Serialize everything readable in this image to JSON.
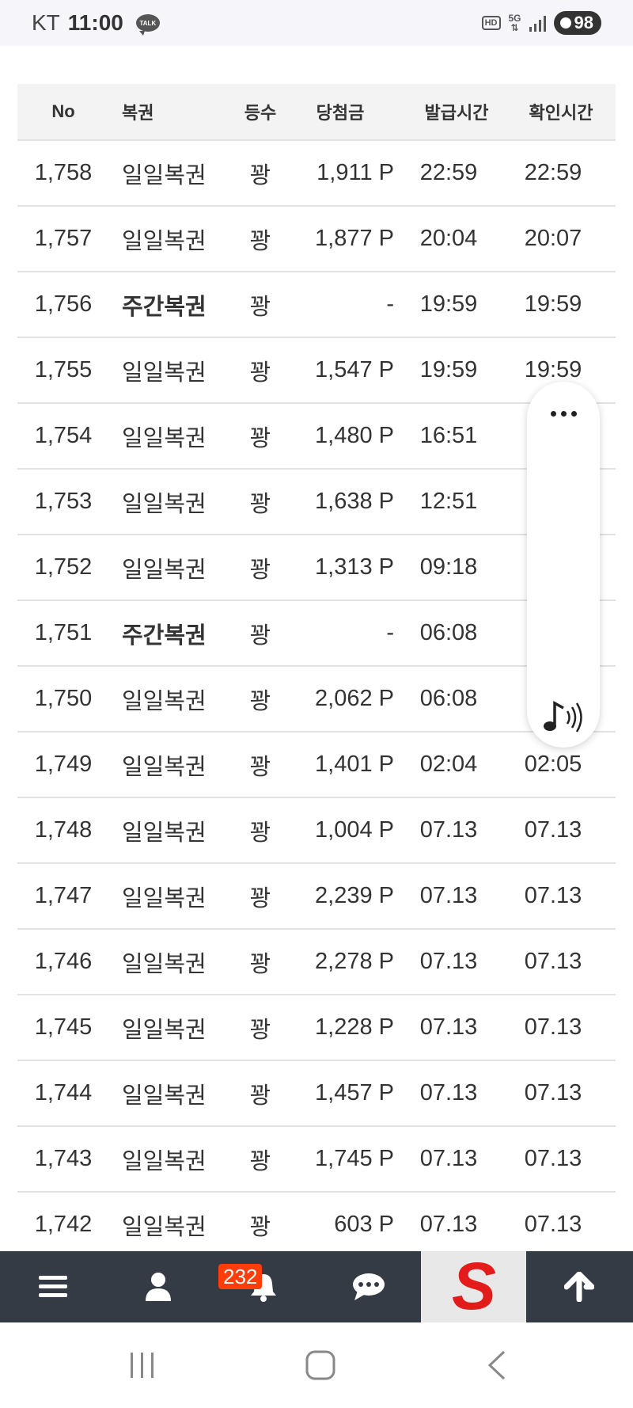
{
  "status_bar": {
    "carrier": "KT",
    "time": "11:00",
    "talk_label": "TALK",
    "hd_label": "HD",
    "network_label": "5G",
    "battery": "98"
  },
  "table": {
    "headers": {
      "no": "No",
      "type": "복권",
      "rank": "등수",
      "prize": "당첨금",
      "issue_time": "발급시간",
      "check_time": "확인시간"
    },
    "rows": [
      {
        "no": "1,758",
        "type": "일일복권",
        "weekly": false,
        "rank": "꽝",
        "prize": "1,911 P",
        "issue_time": "22:59",
        "check_time": "22:59"
      },
      {
        "no": "1,757",
        "type": "일일복권",
        "weekly": false,
        "rank": "꽝",
        "prize": "1,877 P",
        "issue_time": "20:04",
        "check_time": "20:07"
      },
      {
        "no": "1,756",
        "type": "주간복권",
        "weekly": true,
        "rank": "꽝",
        "prize": "-",
        "issue_time": "19:59",
        "check_time": "19:59"
      },
      {
        "no": "1,755",
        "type": "일일복권",
        "weekly": false,
        "rank": "꽝",
        "prize": "1,547 P",
        "issue_time": "19:59",
        "check_time": "19:59"
      },
      {
        "no": "1,754",
        "type": "일일복권",
        "weekly": false,
        "rank": "꽝",
        "prize": "1,480 P",
        "issue_time": "16:51",
        "check_time": ""
      },
      {
        "no": "1,753",
        "type": "일일복권",
        "weekly": false,
        "rank": "꽝",
        "prize": "1,638 P",
        "issue_time": "12:51",
        "check_time": ""
      },
      {
        "no": "1,752",
        "type": "일일복권",
        "weekly": false,
        "rank": "꽝",
        "prize": "1,313 P",
        "issue_time": "09:18",
        "check_time": ""
      },
      {
        "no": "1,751",
        "type": "주간복권",
        "weekly": true,
        "rank": "꽝",
        "prize": "-",
        "issue_time": "06:08",
        "check_time": ""
      },
      {
        "no": "1,750",
        "type": "일일복권",
        "weekly": false,
        "rank": "꽝",
        "prize": "2,062 P",
        "issue_time": "06:08",
        "check_time": ""
      },
      {
        "no": "1,749",
        "type": "일일복권",
        "weekly": false,
        "rank": "꽝",
        "prize": "1,401 P",
        "issue_time": "02:04",
        "check_time": "02:05"
      },
      {
        "no": "1,748",
        "type": "일일복권",
        "weekly": false,
        "rank": "꽝",
        "prize": "1,004 P",
        "issue_time": "07.13",
        "check_time": "07.13"
      },
      {
        "no": "1,747",
        "type": "일일복권",
        "weekly": false,
        "rank": "꽝",
        "prize": "2,239 P",
        "issue_time": "07.13",
        "check_time": "07.13"
      },
      {
        "no": "1,746",
        "type": "일일복권",
        "weekly": false,
        "rank": "꽝",
        "prize": "2,278 P",
        "issue_time": "07.13",
        "check_time": "07.13"
      },
      {
        "no": "1,745",
        "type": "일일복권",
        "weekly": false,
        "rank": "꽝",
        "prize": "1,228 P",
        "issue_time": "07.13",
        "check_time": "07.13"
      },
      {
        "no": "1,744",
        "type": "일일복권",
        "weekly": false,
        "rank": "꽝",
        "prize": "1,457 P",
        "issue_time": "07.13",
        "check_time": "07.13"
      },
      {
        "no": "1,743",
        "type": "일일복권",
        "weekly": false,
        "rank": "꽝",
        "prize": "1,745 P",
        "issue_time": "07.13",
        "check_time": "07.13"
      },
      {
        "no": "1,742",
        "type": "일일복권",
        "weekly": false,
        "rank": "꽝",
        "prize": "603 P",
        "issue_time": "07.13",
        "check_time": "07.13"
      }
    ]
  },
  "floating_widget": {
    "icons": [
      "more-icon",
      "music-sound-icon"
    ]
  },
  "bottom_nav": {
    "items": [
      "menu-icon",
      "user-icon",
      "bell-icon",
      "chat-icon",
      "site-logo",
      "arrow-up-icon"
    ],
    "notification_count": "232",
    "logo_letter": "S"
  },
  "system_nav": {
    "items": [
      "recent-apps-icon",
      "home-icon",
      "back-icon"
    ]
  },
  "colors": {
    "nav_background": "#353b45",
    "badge": "#ff3d0b",
    "header_background": "#f3f3f3",
    "logo_red": "#e31b1b"
  }
}
